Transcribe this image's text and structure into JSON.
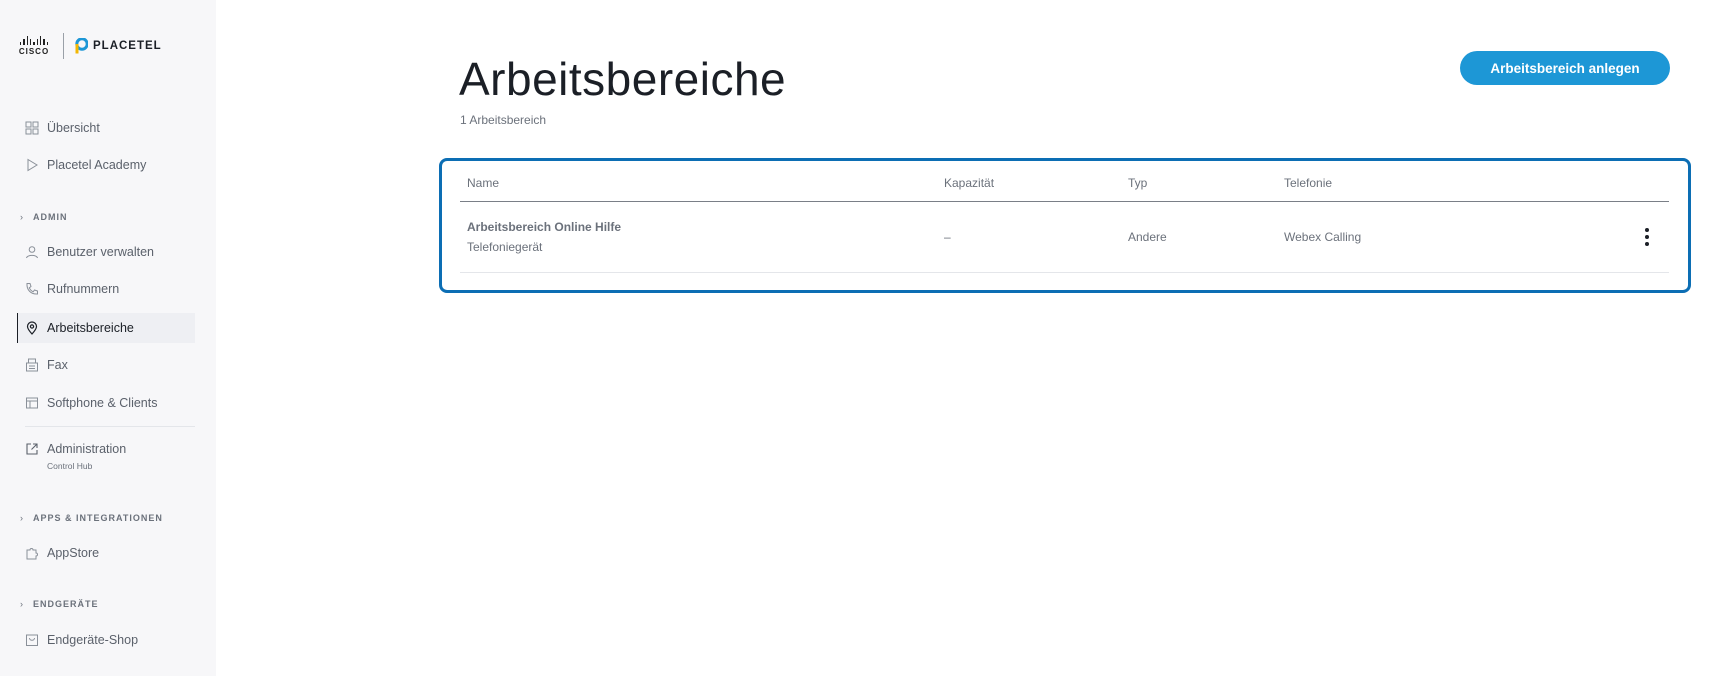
{
  "brand": {
    "cisco": "CISCO",
    "placetel": "PLACETEL",
    "placetel_color": "#1d97d6"
  },
  "sidebar": {
    "items_top": [
      {
        "label": "Übersicht",
        "icon": "grid-icon"
      },
      {
        "label": "Placetel Academy",
        "icon": "play-icon"
      }
    ],
    "section_admin": "ADMIN",
    "items_admin": [
      {
        "label": "Benutzer verwalten",
        "icon": "user-icon"
      },
      {
        "label": "Rufnummern",
        "icon": "phone-icon"
      },
      {
        "label": "Arbeitsbereiche",
        "icon": "location-pin-icon",
        "active": true
      },
      {
        "label": "Fax",
        "icon": "fax-icon"
      },
      {
        "label": "Softphone & Clients",
        "icon": "window-icon"
      }
    ],
    "administration": {
      "label": "Administration",
      "sub": "Control Hub",
      "icon": "external-link-icon"
    },
    "section_apps": "APPS & INTEGRATIONEN",
    "appstore": {
      "label": "AppStore",
      "icon": "puzzle-icon"
    },
    "section_devices": "ENDGERÄTE",
    "device_shop": {
      "label": "Endgeräte-Shop",
      "icon": "shopping-bag-icon"
    }
  },
  "main": {
    "title": "Arbeitsbereiche",
    "count": "1 Arbeitsbereich",
    "create_button": "Arbeitsbereich anlegen",
    "table": {
      "headers": [
        "Name",
        "Kapazität",
        "Typ",
        "Telefonie"
      ],
      "rows": [
        {
          "name": "Arbeitsbereich Online Hilfe",
          "subtitle": "Telefoniegerät",
          "capacity": "–",
          "type": "Andere",
          "telephony": "Webex Calling"
        }
      ]
    }
  },
  "colors": {
    "accent": "#1d97d6",
    "highlight_frame": "#0c6eb4",
    "sidebar_bg": "#f7f7f9"
  }
}
